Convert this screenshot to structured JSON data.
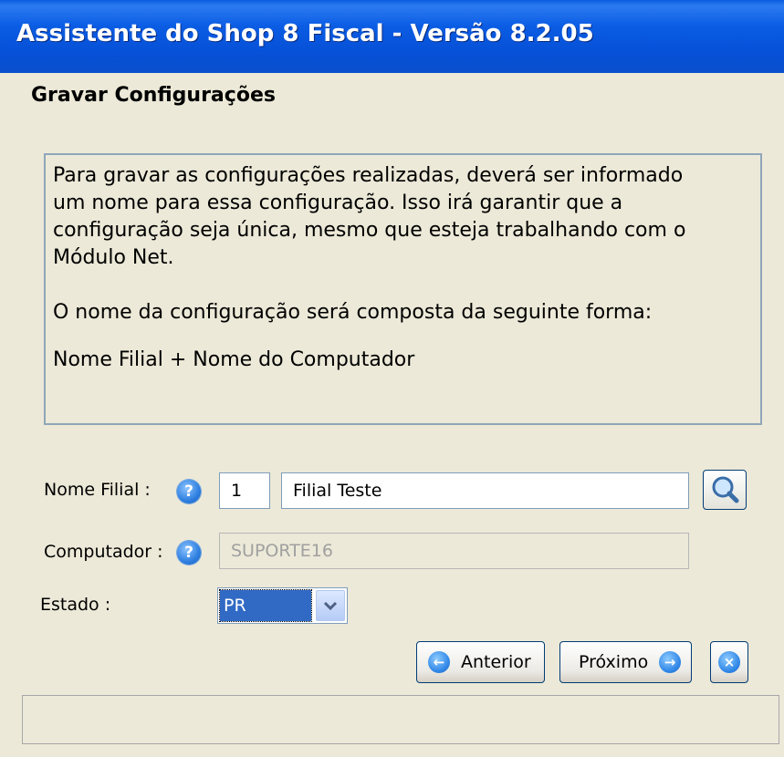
{
  "window": {
    "title": "Assistente do Shop 8 Fiscal - Versão 8.2.05"
  },
  "page": {
    "heading": "Gravar Configurações"
  },
  "info": {
    "paragraph1": "Para gravar as configurações realizadas, deverá ser informado\num nome para essa configuração. Isso irá garantir que a\nconfiguração seja única, mesmo que esteja trabalhando com o\nMódulo Net.",
    "paragraph2": "O nome da configuração será composta da seguinte forma:",
    "paragraph3": "Nome Filial + Nome do Computador"
  },
  "form": {
    "filial": {
      "label": "Nome Filial :",
      "code": "1",
      "name": "Filial Teste"
    },
    "computador": {
      "label": "Computador :",
      "value": "SUPORTE16"
    },
    "estado": {
      "label": "Estado :",
      "value": "PR"
    },
    "help_glyph": "?"
  },
  "buttons": {
    "anterior": "Anterior",
    "proximo": "Próximo",
    "prev_glyph": "←",
    "next_glyph": "→",
    "close_glyph": "×"
  },
  "icons": {
    "help": "help-icon",
    "search": "magnifier-icon",
    "prev": "arrow-left-icon",
    "next": "arrow-right-icon",
    "close": "close-icon",
    "dropdown": "chevron-down-icon"
  },
  "colors": {
    "titlebar": "#0A5BE0",
    "window_bg": "#ECE9D8",
    "selection": "#316AC5",
    "accent_blue": "#2E7FE0"
  }
}
